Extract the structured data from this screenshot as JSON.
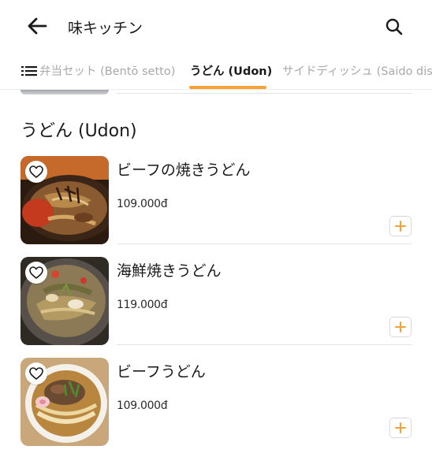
{
  "header": {
    "title": "味キッチン",
    "back_icon": "arrow-left-icon",
    "search_icon": "search-icon"
  },
  "tabs": {
    "menu_icon": "list-menu-icon",
    "items": [
      {
        "label": "弁当セット (Bentō setto)",
        "active": false
      },
      {
        "label": "うどん (Udon)",
        "active": true
      },
      {
        "label": "サイドディッシュ (Saido dis",
        "active": false
      }
    ]
  },
  "accent_color": "#f5a133",
  "section": {
    "title": "うどん (Udon)"
  },
  "items": [
    {
      "name": "ビーフの焼きうどん",
      "price": "109.000đ",
      "favorite_icon": "heart-outline-icon",
      "add_icon": "plus-icon",
      "image": "yaki-udon-beef-photo"
    },
    {
      "name": "海鮮焼きうどん",
      "price": "119.000đ",
      "favorite_icon": "heart-outline-icon",
      "add_icon": "plus-icon",
      "image": "seafood-yaki-udon-photo"
    },
    {
      "name": "ビーフうどん",
      "price": "109.000đ",
      "favorite_icon": "heart-outline-icon",
      "add_icon": "plus-icon",
      "image": "beef-udon-soup-photo"
    }
  ]
}
